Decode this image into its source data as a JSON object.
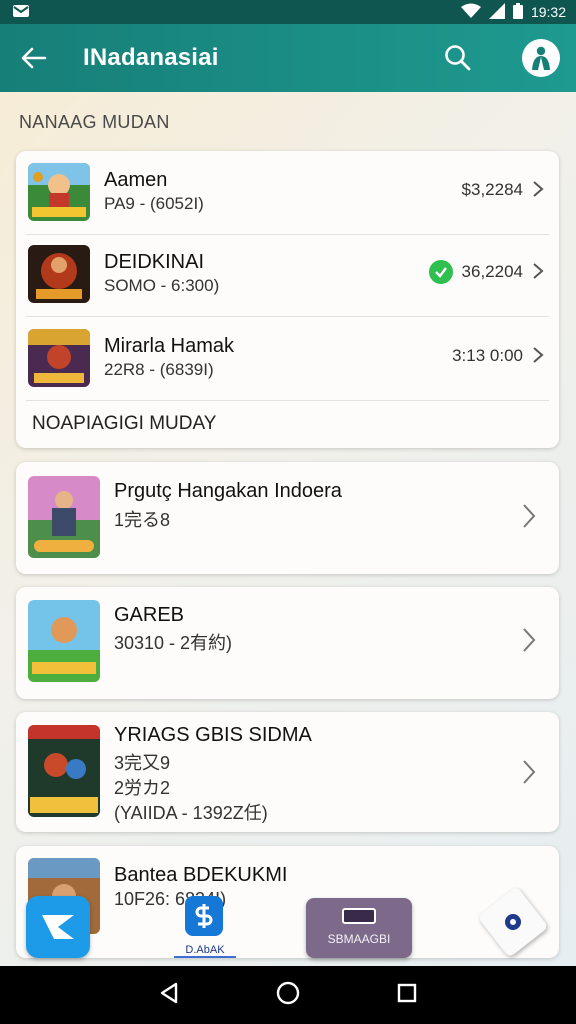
{
  "status_bar": {
    "time": "19:32"
  },
  "app_bar": {
    "title": "INadanasiai"
  },
  "section_header": "NANAAG MUDAN",
  "list_items": [
    {
      "name": "Aamen",
      "sub": "PA9 - (6052I)",
      "price": "$3,2284"
    },
    {
      "name": "DEIDKINAI",
      "sub": "SOMO - 6:300)",
      "price": "36,2204"
    },
    {
      "name": "Mirarla Hamak",
      "sub": "22R8 - (6839I)",
      "price": "3:13 0:00"
    }
  ],
  "sub_section_header": "NOAPIAGIGI MUDAY",
  "cards": [
    {
      "name": "Prgutç Hangakan Indoera",
      "lines": [
        "1完る8"
      ]
    },
    {
      "name": "GAREB",
      "lines": [
        "30310 - 2有約)"
      ]
    },
    {
      "name": "YRIAGS GBIS SIDMA",
      "lines": [
        "3完又9",
        "2労カ2",
        "(YAIIDA - 1392Z任)"
      ]
    },
    {
      "name": "Bantea BDEKUKMI",
      "lines": [
        "10F26: 6834I)"
      ]
    }
  ],
  "bottom_actions": {
    "dashboard_label": "D.AbAK",
    "store_label": "SBMAAGBI"
  },
  "colors": {
    "app_bar": "#1b8f86",
    "status_bar": "#0f5550",
    "check_green": "#2fbf4f",
    "fab_blue": "#1e9be8"
  }
}
